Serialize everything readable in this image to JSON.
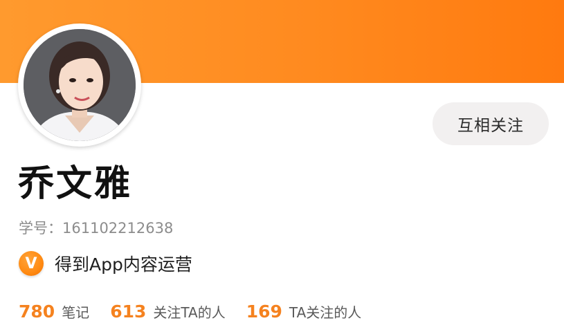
{
  "profile": {
    "name": "乔文雅",
    "student_id_label": "学号：",
    "student_id_value": "161102212638",
    "verify_badge": "V",
    "verify_text": "得到App内容运营",
    "follow_button": "互相关注"
  },
  "stats": [
    {
      "value": "780",
      "label": "笔记"
    },
    {
      "value": "613",
      "label": "关注TA的人"
    },
    {
      "value": "169",
      "label": "TA关注的人"
    }
  ],
  "colors": {
    "banner_start": "#ff9a2e",
    "banner_end": "#ff7a0f",
    "accent": "#f5821f",
    "button_bg": "#f2f0f0"
  },
  "icons": {
    "verify": "verified-v-icon"
  }
}
